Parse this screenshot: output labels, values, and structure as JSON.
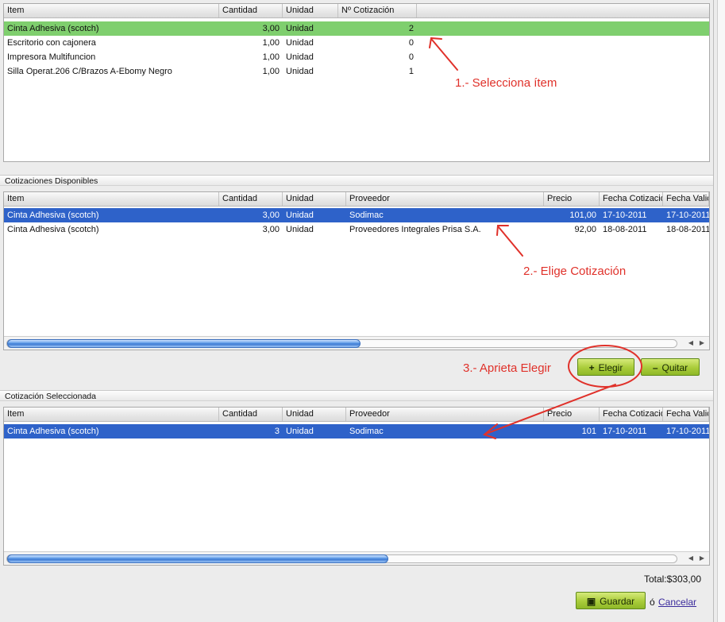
{
  "grid_items": {
    "headers": [
      "Item",
      "Cantidad",
      "Unidad",
      "Nº Cotización"
    ],
    "rows": [
      {
        "item": "Cinta Adhesiva (scotch)",
        "cantidad": "3,00",
        "unidad": "Unidad",
        "cotizacion": "2"
      },
      {
        "item": "Escritorio con cajonera",
        "cantidad": "1,00",
        "unidad": "Unidad",
        "cotizacion": "0"
      },
      {
        "item": "Impresora Multifuncion",
        "cantidad": "1,00",
        "unidad": "Unidad",
        "cotizacion": "0"
      },
      {
        "item": "Silla Operat.206 C/Brazos A-Ebomy Negro",
        "cantidad": "1,00",
        "unidad": "Unidad",
        "cotizacion": "1"
      }
    ]
  },
  "section_disponibles": "Cotizaciones Disponibles",
  "grid_disponibles": {
    "headers": [
      "Item",
      "Cantidad",
      "Unidad",
      "Proveedor",
      "Precio",
      "Fecha Cotizacio",
      "Fecha Valic"
    ],
    "rows": [
      {
        "item": "Cinta Adhesiva (scotch)",
        "cantidad": "3,00",
        "unidad": "Unidad",
        "proveedor": "Sodimac",
        "precio": "101,00",
        "fecha_cot": "17-10-2011",
        "fecha_val": "17-10-2011"
      },
      {
        "item": "Cinta Adhesiva (scotch)",
        "cantidad": "3,00",
        "unidad": "Unidad",
        "proveedor": "Proveedores Integrales Prisa S.A.",
        "precio": "92,00",
        "fecha_cot": "18-08-2011",
        "fecha_val": "18-08-2011"
      }
    ]
  },
  "buttons": {
    "elegir": "Elegir",
    "quitar": "Quitar",
    "guardar": "Guardar",
    "or": "ó",
    "cancelar": "Cancelar"
  },
  "section_seleccionada": "Cotización Seleccionada",
  "grid_seleccionada": {
    "headers": [
      "Item",
      "Cantidad",
      "Unidad",
      "Proveedor",
      "Precio",
      "Fecha Cotizacio",
      "Fecha Valic"
    ],
    "rows": [
      {
        "item": "Cinta Adhesiva (scotch)",
        "cantidad": "3",
        "unidad": "Unidad",
        "proveedor": "Sodimac",
        "precio": "101",
        "fecha_cot": "17-10-2011",
        "fecha_val": "17-10-2011"
      }
    ]
  },
  "total": "Total:$303,00",
  "annotations": {
    "step1": "1.- Selecciona ítem",
    "step2": "2.- Elige Cotización",
    "step3": "3.- Aprieta Elegir"
  },
  "colors": {
    "annotation": "#e0312a",
    "selected_green": "#7fcf6e",
    "selected_blue": "#2e62c9",
    "button_green": "#a9cc3a"
  }
}
